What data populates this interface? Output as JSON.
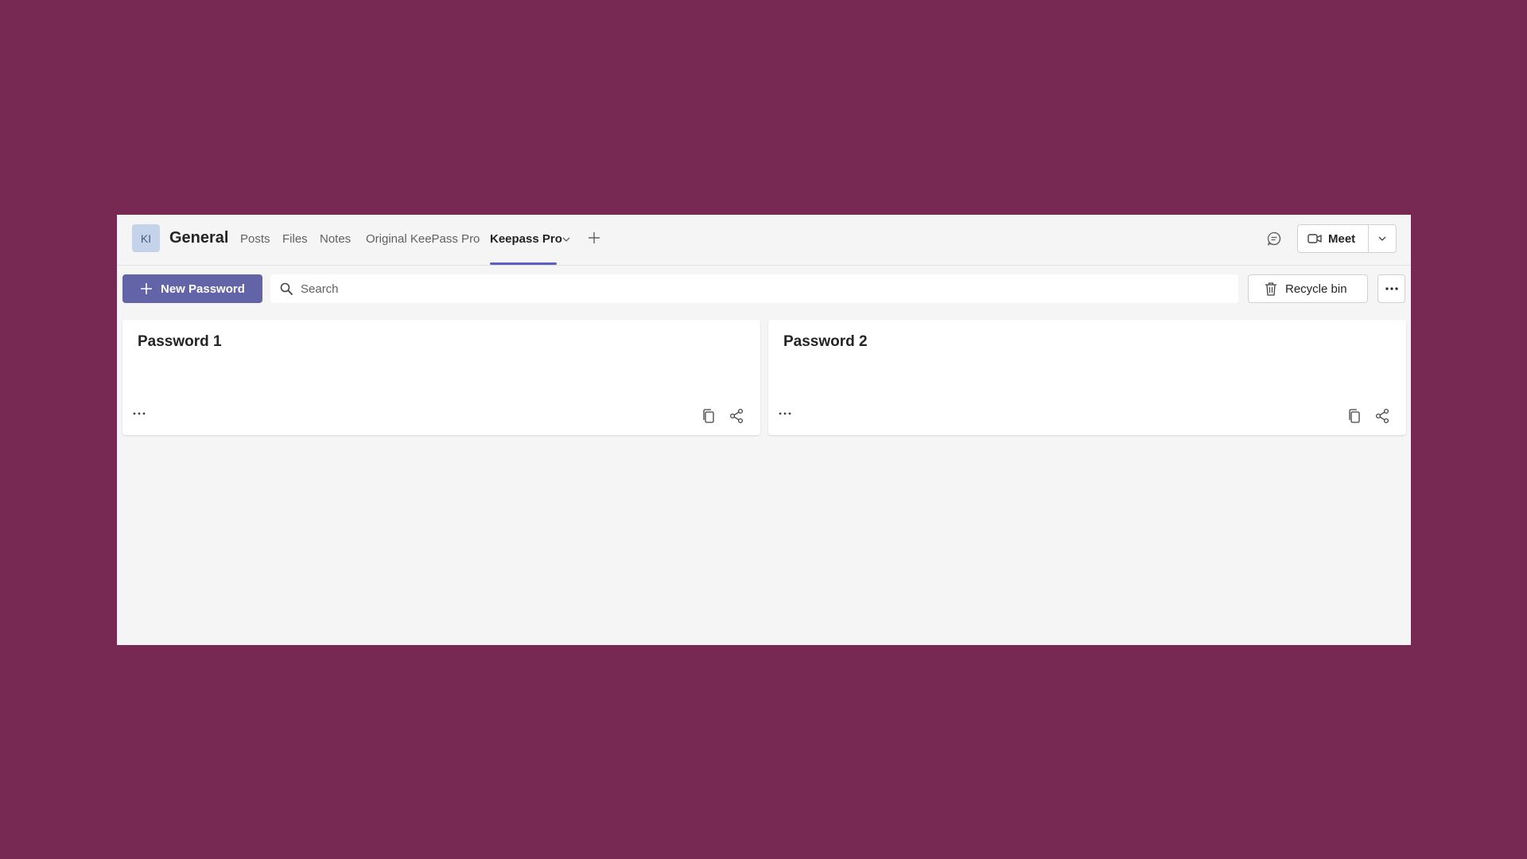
{
  "header": {
    "avatar_initials": "KI",
    "channel_title": "General",
    "tabs": [
      {
        "label": "Posts"
      },
      {
        "label": "Files"
      },
      {
        "label": "Notes"
      },
      {
        "label": "Original KeePass Pro"
      },
      {
        "label": "Keepass Pro",
        "active": true
      }
    ],
    "meet_label": "Meet"
  },
  "toolbar": {
    "new_password_label": "New Password",
    "search_placeholder": "Search",
    "search_value": "",
    "recycle_bin_label": "Recycle bin"
  },
  "cards": [
    {
      "title": "Password 1"
    },
    {
      "title": "Password 2"
    }
  ],
  "colors": {
    "background": "#772953",
    "accent": "#6264a7",
    "tab_underline": "#5b5fc7",
    "surface": "#f5f5f5"
  },
  "icons": [
    "plus-icon",
    "chevron-down-icon",
    "chat-icon",
    "video-camera-icon",
    "search-icon",
    "trash-icon",
    "more-icon",
    "copy-icon",
    "share-icon"
  ]
}
